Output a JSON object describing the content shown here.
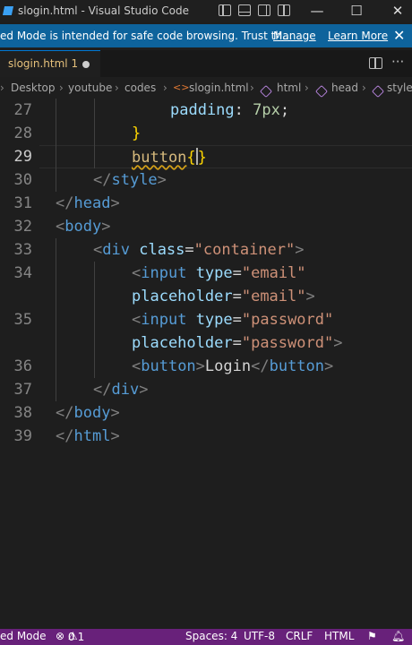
{
  "window": {
    "title": "slogin.html - Visual Studio Code",
    "minimize": "—",
    "maximize": "☐",
    "close": "✕"
  },
  "banner": {
    "message": "ed Mode is intended for safe code browsing. Trust th...",
    "manage": "Manage",
    "learn_more": "Learn More",
    "close": "✕"
  },
  "tab": {
    "filename": "slogin.html",
    "problems": "1"
  },
  "breadcrumb": [
    "Desktop",
    "youtube",
    "codes",
    "slogin.html",
    "html",
    "head",
    "style"
  ],
  "editor": {
    "lines": [
      {
        "n": "27"
      },
      {
        "n": "28"
      },
      {
        "n": "29"
      },
      {
        "n": "30"
      },
      {
        "n": "31"
      },
      {
        "n": "32"
      },
      {
        "n": "33"
      },
      {
        "n": "34"
      },
      {
        "n": "35"
      },
      {
        "n": "36"
      },
      {
        "n": "37"
      },
      {
        "n": "38"
      },
      {
        "n": "39"
      }
    ],
    "l27_prop": "padding",
    "l27_val": "7px",
    "l29_sel": "button",
    "l_style": "style",
    "l_head": "head",
    "l_body": "body",
    "l_div": "div",
    "attr_class": "class",
    "val_container": "\"container\"",
    "l_input": "input",
    "attr_type": "type",
    "val_email": "\"email\"",
    "attr_placeholder": "placeholder",
    "val_password": "\"password\"",
    "l_button": "button",
    "button_text": "Login",
    "l_html": "html"
  },
  "status": {
    "mode": "ed Mode",
    "errors": "0",
    "warnings": "1",
    "spaces": "Spaces: 4",
    "encoding": "UTF-8",
    "eol": "CRLF",
    "language": "HTML"
  },
  "colors": {
    "accent": "#0e639c",
    "statusbar": "#68217a",
    "tag": "#569cd6",
    "attribute": "#9cdcfe",
    "string": "#ce9178",
    "selector": "#d7ba7d"
  }
}
